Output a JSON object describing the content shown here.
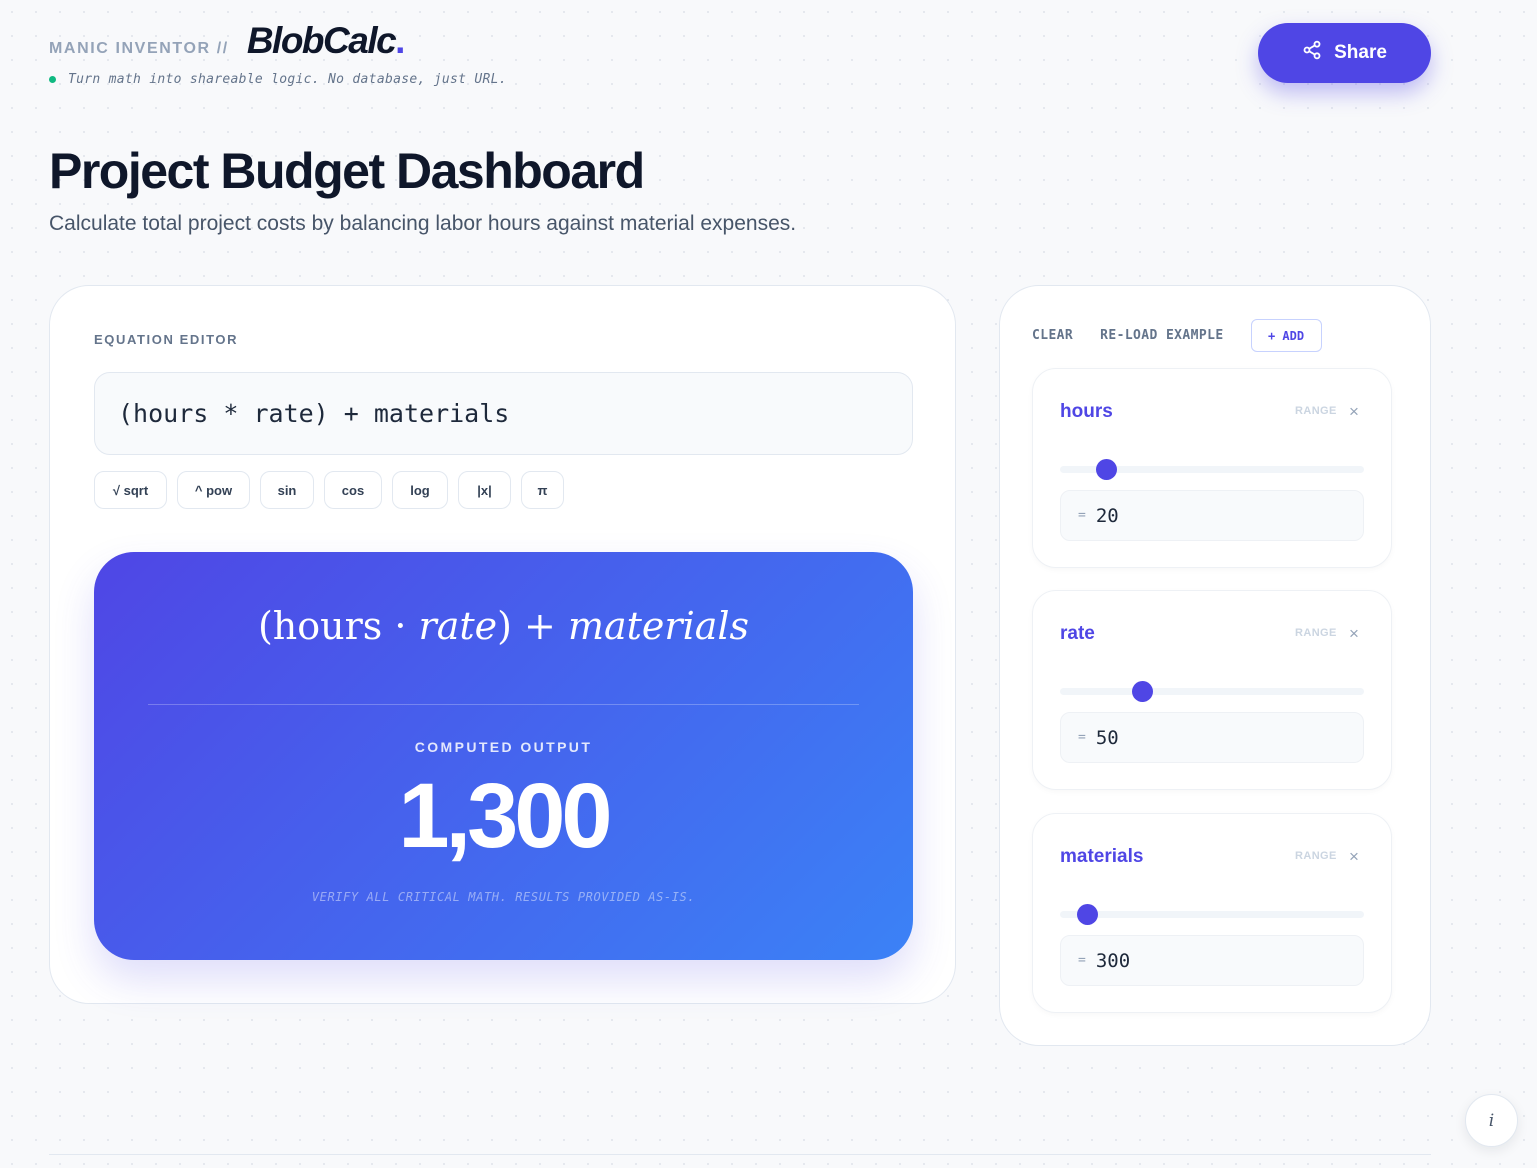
{
  "header": {
    "brand_tag": "MANIC INVENTOR //",
    "logo": "BlobCalc",
    "logo_dot": ".",
    "tagline": "Turn math into shareable logic. No database, just URL.",
    "status_color": "#10b981",
    "share_label": "Share",
    "share_icon": "share-icon"
  },
  "page": {
    "title": "Project Budget Dashboard",
    "subtitle": "Calculate total project costs by balancing labor hours against material expenses."
  },
  "editor": {
    "section_label": "EQUATION EDITOR",
    "equation": "(hours * rate) + materials",
    "functions": [
      {
        "label": "√ sqrt"
      },
      {
        "label": "^ pow"
      },
      {
        "label": "sin"
      },
      {
        "label": "cos"
      },
      {
        "label": "log"
      },
      {
        "label": "|x|"
      },
      {
        "label": "π"
      }
    ]
  },
  "result": {
    "rendered": {
      "open": "(hours · ",
      "rate": "rate",
      "close": ") + ",
      "materials": "materials"
    },
    "output_label": "COMPUTED OUTPUT",
    "output_value": "1,300",
    "disclaimer": "VERIFY ALL CRITICAL MATH. RESULTS PROVIDED AS-IS.",
    "accent_start": "#4f46e5",
    "accent_end": "#3b82f6"
  },
  "variables_panel": {
    "clear_label": "CLEAR",
    "reload_label": "RE-LOAD EXAMPLE",
    "add_label": "+ ADD",
    "range_label": "RANGE",
    "remove_glyph": "×",
    "eq_sign": "=",
    "variables": [
      {
        "name": "hours",
        "value": "20",
        "slider_fraction": 0.15
      },
      {
        "name": "rate",
        "value": "50",
        "slider_fraction": 0.27
      },
      {
        "name": "materials",
        "value": "300",
        "slider_fraction": 0.09
      }
    ]
  },
  "misc": {
    "info_glyph": "i",
    "info_icon": "info-icon"
  }
}
